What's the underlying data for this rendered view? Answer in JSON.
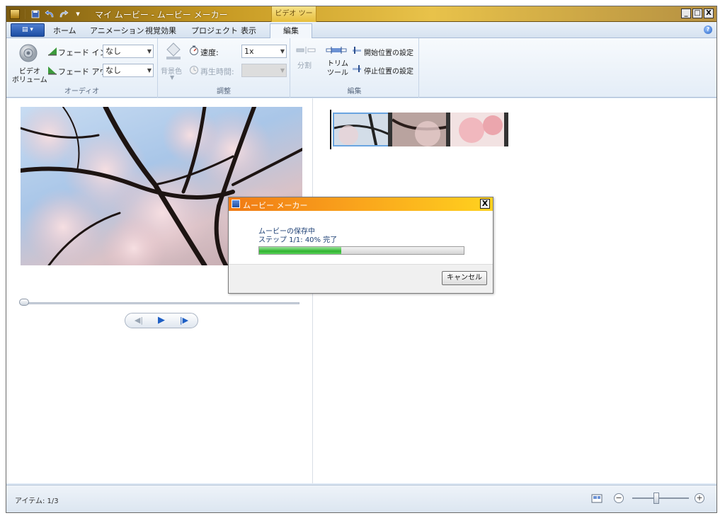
{
  "window": {
    "title": "マイ ムービー - ムービー メーカー",
    "context_tab": "ビデオ ツール",
    "controls": {
      "minimize": "_",
      "maximize": "□",
      "close": "X"
    }
  },
  "tabs": [
    {
      "label": "ホーム"
    },
    {
      "label": "アニメーション"
    },
    {
      "label": "視覚効果"
    },
    {
      "label": "プロジェクト"
    },
    {
      "label": "表示"
    },
    {
      "label": "編集",
      "active": true
    }
  ],
  "ribbon": {
    "audio": {
      "label": "オーディオ",
      "video_volume": "ビデオ\nボリューム",
      "fade_in_label": "フェード イン:",
      "fade_in_value": "なし",
      "fade_out_label": "フェード アウト:",
      "fade_out_value": "なし"
    },
    "adjust": {
      "label": "調整",
      "background_color": "背景色",
      "speed_label": "速度:",
      "speed_value": "1x",
      "duration_label": "再生時間:",
      "duration_value": ""
    },
    "edit": {
      "label": "編集",
      "split": "分割",
      "trim_tool": "トリム\nツール",
      "set_start": "開始位置の設定",
      "set_end": "停止位置の設定"
    }
  },
  "status": {
    "items": "アイテム: 1/3"
  },
  "dialog": {
    "title": "ムービー メーカー",
    "line1": "ムービーの保存中",
    "line2": "ステップ 1/1: 40% 完了",
    "progress": 0.4,
    "cancel": "キャンセル",
    "close": "X"
  },
  "zoom": {
    "level": 0.4
  },
  "colors": {
    "title_gradient": "#c79a23",
    "dialog_title": "#f9a11c",
    "progress_fill": "#2fb32f",
    "accent_blue": "#1d4ea3"
  }
}
